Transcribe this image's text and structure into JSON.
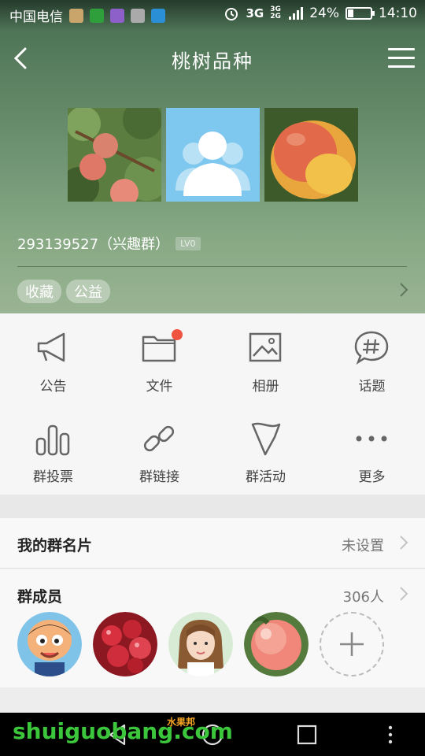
{
  "status_bar": {
    "carrier": "中国电信",
    "network": "3G",
    "network2": "3G 2G",
    "battery_percent": "24%",
    "battery_level": 0.24,
    "time": "14:10"
  },
  "header": {
    "title": "桃树品种"
  },
  "group": {
    "id_label": "293139527（兴趣群）",
    "level": "LV0",
    "tags": [
      "收藏",
      "公益"
    ]
  },
  "features": [
    {
      "label": "公告",
      "icon": "megaphone-icon"
    },
    {
      "label": "文件",
      "icon": "folder-icon"
    },
    {
      "label": "相册",
      "icon": "image-icon"
    },
    {
      "label": "话题",
      "icon": "hashtag-icon"
    },
    {
      "label": "群投票",
      "icon": "bar-chart-icon"
    },
    {
      "label": "群链接",
      "icon": "link-icon"
    },
    {
      "label": "群活动",
      "icon": "flag-icon"
    },
    {
      "label": "更多",
      "icon": "more-icon"
    }
  ],
  "card": {
    "label": "我的群名片",
    "value": "未设置"
  },
  "members": {
    "label": "群成员",
    "count": "306人"
  },
  "watermark": {
    "main": "shuiguobang.com",
    "sub": "水果邦"
  },
  "colors": {
    "accent_red": "#f0533f",
    "hero_green": "#6b9070"
  }
}
